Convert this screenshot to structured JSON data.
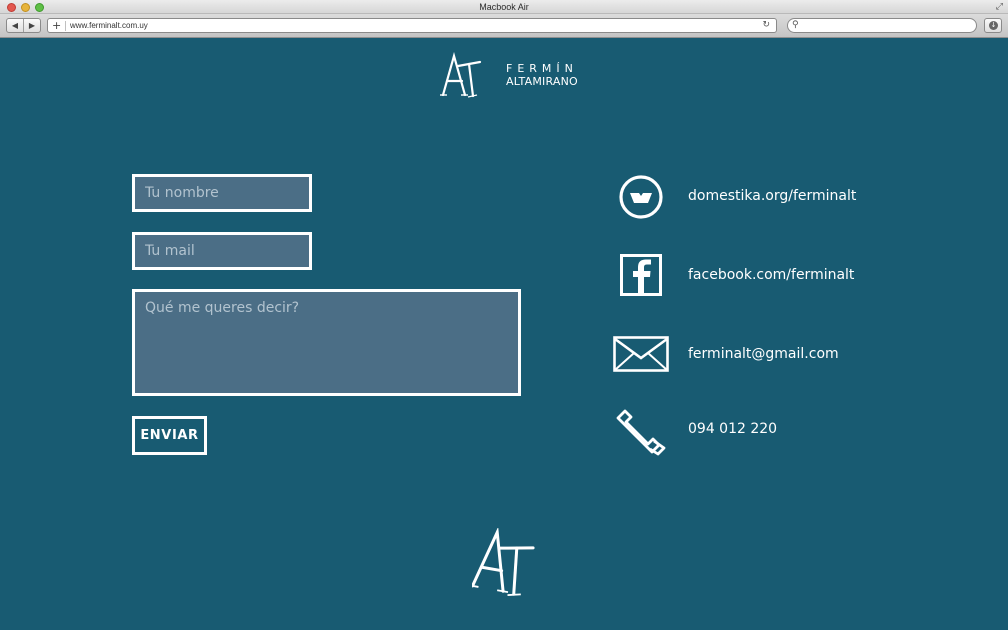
{
  "browser": {
    "window_title": "Macbook Air",
    "url": "www.ferminalt.com.uy",
    "back_glyph": "◀",
    "forward_glyph": "▶",
    "plus_glyph": "+",
    "reload_glyph": "↻",
    "search_glyph": "⚲",
    "download_glyph": "↓",
    "fullscreen_glyph": "⤢"
  },
  "brand": {
    "first_name": "FERMÍN",
    "last_name": "ALTAMIRANO"
  },
  "form": {
    "name_placeholder": "Tu nombre",
    "mail_placeholder": "Tu mail",
    "message_placeholder": "Qué me queres decir?",
    "send_label": "ENVIAR"
  },
  "contacts": {
    "domestika": "domestika.org/ferminalt",
    "facebook": "facebook.com/ferminalt",
    "email": "ferminalt@gmail.com",
    "phone": "094 012 220"
  },
  "colors": {
    "background": "#185b72",
    "field_fill": "#4b6e86",
    "foreground": "#ffffff"
  },
  "icons": [
    "domestika-icon",
    "facebook-icon",
    "mail-icon",
    "phone-icon",
    "brand-logo"
  ]
}
